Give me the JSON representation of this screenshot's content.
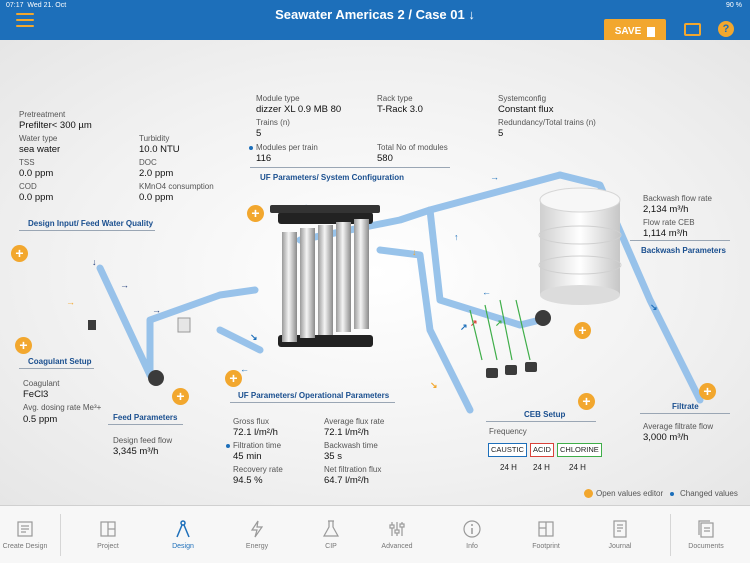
{
  "status": {
    "time": "07:17",
    "date": "Wed 21. Oct",
    "battery": "90 %"
  },
  "header": {
    "title": "Seawater Americas 2 / Case 01 ↓",
    "save_label": "SAVE",
    "help": "?"
  },
  "design_input": {
    "pretreatment_label": "Pretreatment",
    "pretreatment": "Prefilter< 300 µm",
    "water_type_label": "Water type",
    "water_type": "sea water",
    "turbidity_label": "Turbidity",
    "turbidity": "10.0 NTU",
    "tss_label": "TSS",
    "tss": "0.0 ppm",
    "doc_label": "DOC",
    "doc": "2.0 ppm",
    "cod_label": "COD",
    "cod": "0.0 ppm",
    "kmno4_label": "KMnO4 consumption",
    "kmno4": "0.0 ppm",
    "section": "Design Input/ Feed Water Quality"
  },
  "system_config": {
    "module_type_label": "Module type",
    "module_type": "dizzer XL 0.9 MB 80",
    "rack_type_label": "Rack type",
    "rack_type": "T-Rack 3.0",
    "systemconfig_label": "Systemconfig",
    "systemconfig": "Constant flux",
    "trains_label": "Trains (n)",
    "trains": "5",
    "redundancy_label": "Redundancy/Total trains (n)",
    "redundancy": "5",
    "modules_label": "Modules per train",
    "modules": "116",
    "total_label": "Total No of modules",
    "total": "580",
    "section": "UF Parameters/ System Configuration"
  },
  "backwash": {
    "flow_rate_label": "Backwash flow rate",
    "flow_rate": "2,134 m³/h",
    "ceb_label": "Flow rate CEB",
    "ceb": "1,114 m³/h",
    "section": "Backwash Parameters"
  },
  "coagulant": {
    "section": "Coagulant Setup",
    "coagulant_label": "Coagulant",
    "coagulant": "FeCl3",
    "dosing_label": "Avg. dosing rate Me³+",
    "dosing": "0.5 ppm"
  },
  "feed": {
    "section": "Feed Parameters",
    "flow_label": "Design feed flow",
    "flow": "3,345 m³/h"
  },
  "operational": {
    "section": "UF Parameters/ Operational Parameters",
    "gross_flux_label": "Gross flux",
    "gross_flux": "72.1 l/m²/h",
    "avg_flux_label": "Average flux rate",
    "avg_flux": "72.1 l/m²/h",
    "filtration_time_label": "Filtration time",
    "filtration_time": "45 min",
    "backwash_time_label": "Backwash time",
    "backwash_time": "35 s",
    "recovery_label": "Recovery rate",
    "recovery": "94.5 %",
    "net_flux_label": "Net filtration flux",
    "net_flux": "64.7 l/m²/h"
  },
  "ceb": {
    "section": "CEB Setup",
    "frequency_label": "Frequency",
    "chemicals": [
      {
        "name": "CAUSTIC",
        "freq": "24 H",
        "color": "#1d6fba"
      },
      {
        "name": "ACID",
        "freq": "24 H",
        "color": "#d9423a"
      },
      {
        "name": "CHLORINE",
        "freq": "24 H",
        "color": "#3fae49"
      }
    ]
  },
  "filtrate": {
    "section": "Filtrate",
    "flow_label": "Average filtrate flow",
    "flow": "3,000 m³/h"
  },
  "legend": {
    "open_editor": "Open values editor",
    "changed": "Changed values"
  },
  "tabs": [
    {
      "label": "Create Design",
      "icon": "create-design-icon"
    },
    {
      "label": "Project",
      "icon": "project-icon"
    },
    {
      "label": "Design",
      "icon": "design-icon"
    },
    {
      "label": "Energy",
      "icon": "energy-icon"
    },
    {
      "label": "CIP",
      "icon": "cip-icon"
    },
    {
      "label": "Advanced",
      "icon": "advanced-icon"
    },
    {
      "label": "Info",
      "icon": "info-icon"
    },
    {
      "label": "Footprint",
      "icon": "footprint-icon"
    },
    {
      "label": "Journal",
      "icon": "journal-icon"
    },
    {
      "label": "Documents",
      "icon": "documents-icon"
    }
  ],
  "colors": {
    "brand": "#1d6fba",
    "accent": "#f2a72e"
  }
}
